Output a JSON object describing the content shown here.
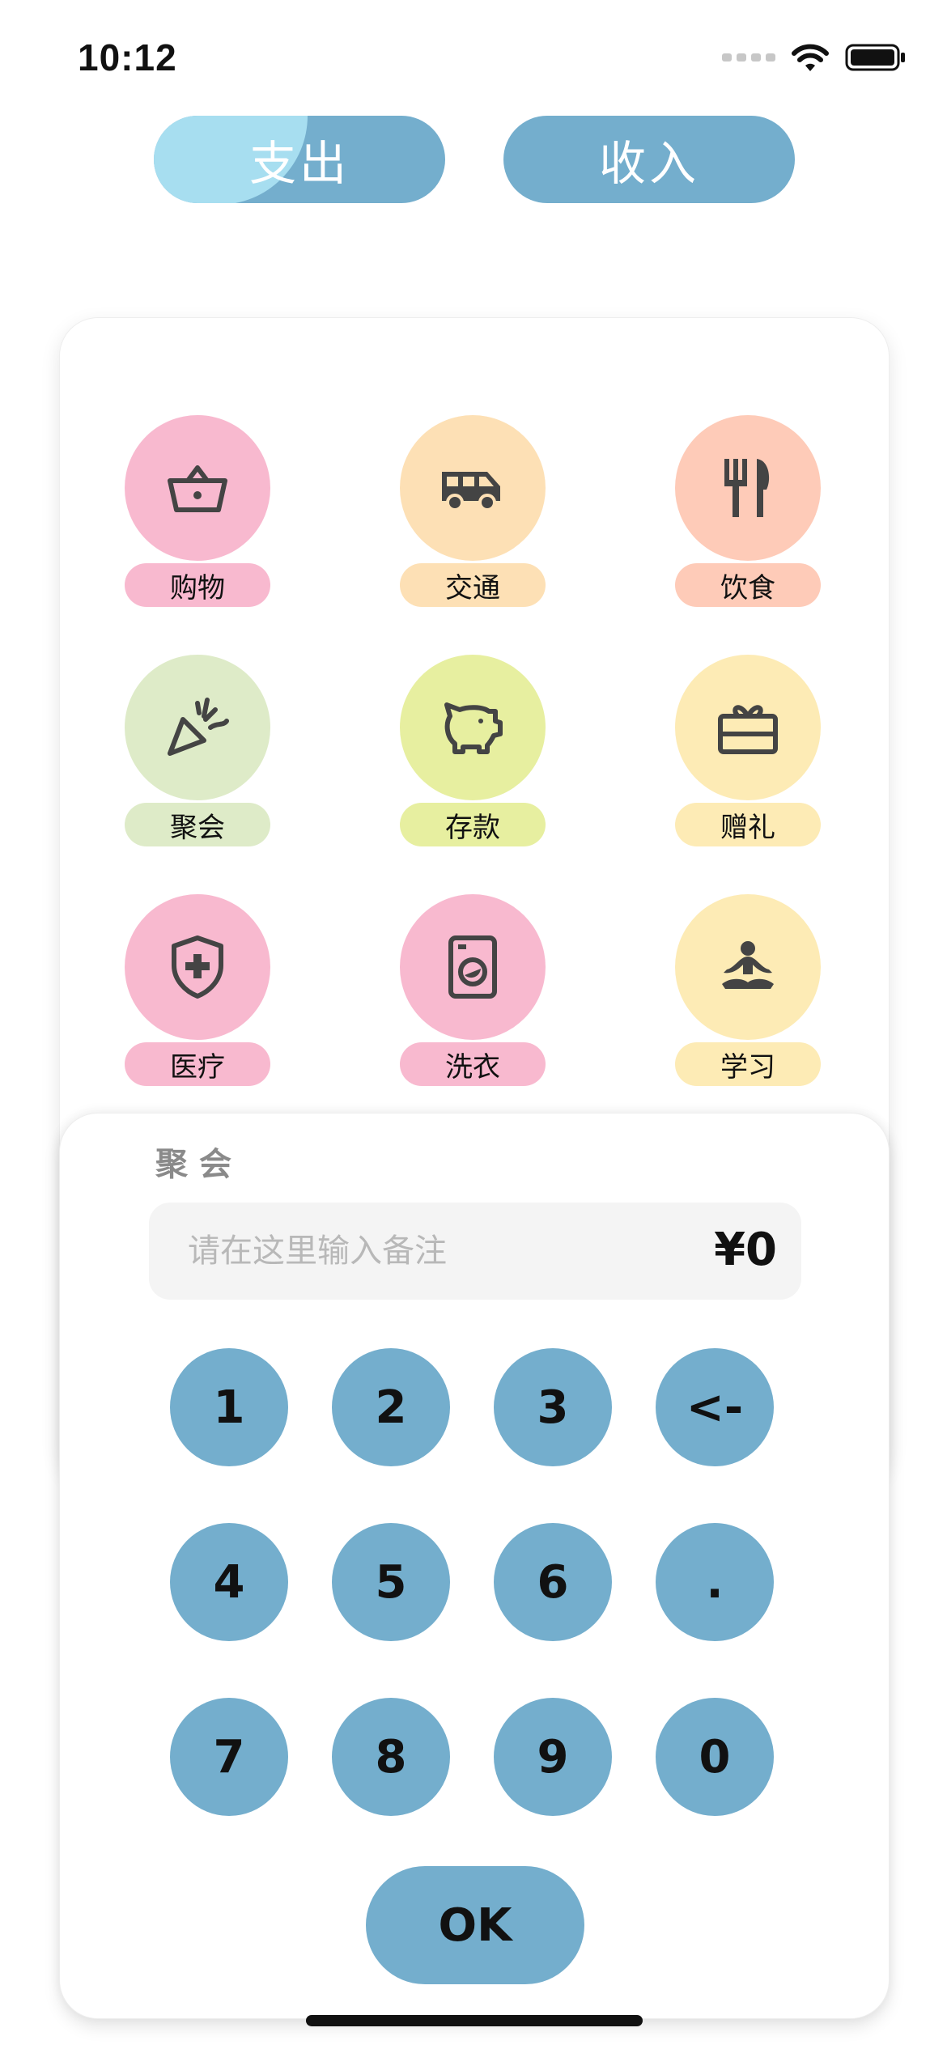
{
  "status_bar": {
    "time": "10:12"
  },
  "segments": {
    "expense": "支出",
    "income": "收入"
  },
  "categories": [
    {
      "label": "购物",
      "icon": "basket-icon"
    },
    {
      "label": "交通",
      "icon": "van-icon"
    },
    {
      "label": "饮食",
      "icon": "fork-knife-icon"
    },
    {
      "label": "聚会",
      "icon": "party-popper-icon"
    },
    {
      "label": "存款",
      "icon": "piggy-bank-icon"
    },
    {
      "label": "赠礼",
      "icon": "gift-icon"
    },
    {
      "label": "医疗",
      "icon": "shield-cross-icon"
    },
    {
      "label": "洗衣",
      "icon": "washing-machine-icon"
    },
    {
      "label": "学习",
      "icon": "meditation-icon"
    }
  ],
  "sheet": {
    "selected_category": "聚会",
    "note_placeholder": "请在这里输入备注",
    "amount": "¥0"
  },
  "keypad": {
    "keys": [
      "1",
      "2",
      "3",
      "<-",
      "4",
      "5",
      "6",
      ".",
      "7",
      "8",
      "9",
      "0"
    ],
    "ok_label": "OK"
  },
  "colors": {
    "accent": "#74aecd",
    "accent_light": "#a7def0",
    "pink": "#f8b9cf",
    "peach": "#fde0b5",
    "salmon": "#fecbb8",
    "green": "#deebc8",
    "lime": "#e7efa0",
    "yellow": "#fdebb5"
  }
}
